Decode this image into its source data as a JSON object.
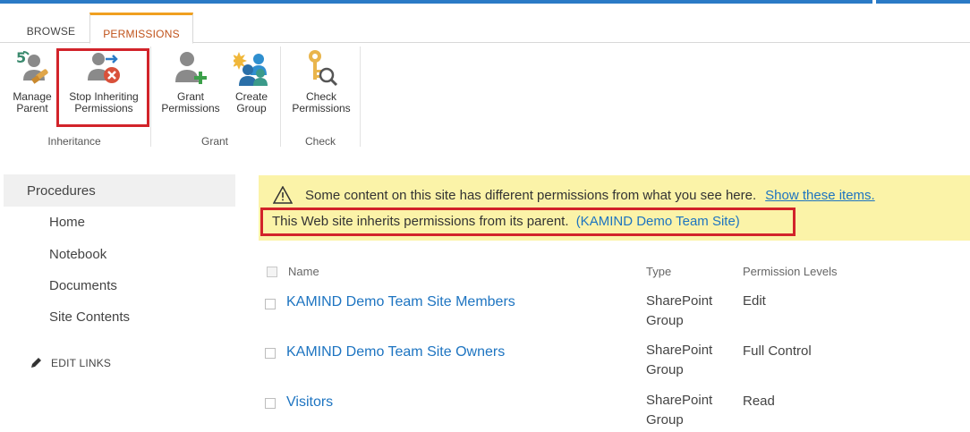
{
  "ribbon": {
    "tabs": [
      {
        "label": "BROWSE"
      },
      {
        "label": "PERMISSIONS"
      }
    ],
    "buttons": {
      "manage_parent": [
        "Manage",
        "Parent"
      ],
      "stop_inheriting": [
        "Stop Inheriting",
        "Permissions"
      ],
      "grant": [
        "Grant",
        "Permissions"
      ],
      "create_group": [
        "Create",
        "Group"
      ],
      "check": [
        "Check",
        "Permissions"
      ]
    },
    "groups": {
      "inheritance": "Inheritance",
      "grant": "Grant",
      "check": "Check"
    }
  },
  "nav": {
    "header": "Procedures",
    "items": [
      "Home",
      "Notebook",
      "Documents",
      "Site Contents"
    ],
    "edit_links": "EDIT LINKS"
  },
  "notice": {
    "message": "Some content on this site has different permissions from what you see here.",
    "link": "Show these items.",
    "inherit_text": "This Web site inherits permissions from its parent.",
    "parent_link": "(KAMIND Demo Team Site)"
  },
  "table": {
    "headers": {
      "name": "Name",
      "type": "Type",
      "levels": "Permission Levels"
    },
    "rows": [
      {
        "name": "KAMIND Demo Team Site Members",
        "type": [
          "SharePoint",
          "Group"
        ],
        "level": "Edit"
      },
      {
        "name": "KAMIND Demo Team Site Owners",
        "type": [
          "SharePoint",
          "Group"
        ],
        "level": "Full Control"
      },
      {
        "name": "Visitors",
        "type": [
          "SharePoint",
          "Group"
        ],
        "level": "Read"
      }
    ]
  },
  "colors": {
    "accent": "#2a7ac6",
    "link": "#1d74c1",
    "highlight": "#d2232a",
    "notice_bg": "#fbf3a8",
    "tab_active": "#c0521a"
  }
}
